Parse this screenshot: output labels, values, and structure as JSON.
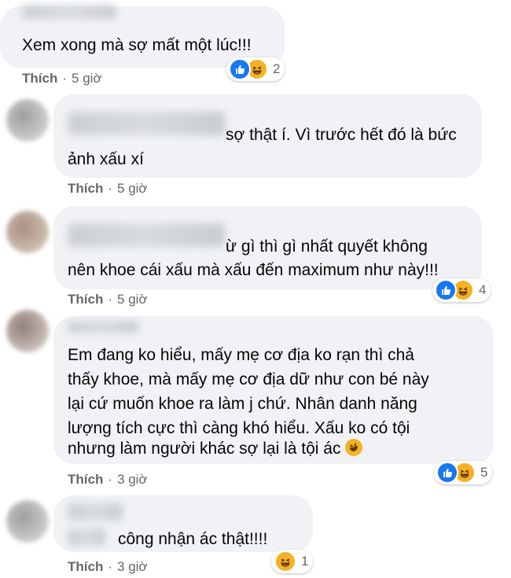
{
  "comments": [
    {
      "text_lines": [
        "Xem xong mà sợ mất một lúc!!!"
      ],
      "like_label": "Thích",
      "time": "5 giờ",
      "reactions": {
        "icons": [
          "like-icon",
          "haha-icon"
        ],
        "count": "2"
      }
    },
    {
      "text_lines": [
        "sợ thật í. Vì trước hết đó là bức",
        "ảnh xấu xí"
      ],
      "like_label": "Thích",
      "time": "5 giờ"
    },
    {
      "text_lines": [
        "ừ gì thì gì nhất quyết không",
        "nên khoe cái xấu mà xấu đến maximum như này!!!"
      ],
      "like_label": "Thích",
      "time": "5 giờ",
      "reactions": {
        "icons": [
          "like-icon",
          "haha-icon"
        ],
        "count": "4"
      }
    },
    {
      "text_lines": [
        "Em đang ko hiểu, mấy mẹ cơ địa ko rạn thì chả",
        "thấy khoe, mà mấy mẹ cơ địa dữ như con bé này",
        "lại cứ muốn khoe ra làm j chứ. Nhân danh năng",
        "lượng tích cực thì càng khó hiểu. Xấu ko có tội",
        "nhưng làm người khác sợ lại là tội ác"
      ],
      "inline_emoji": "rolling-laughing-emoji",
      "like_label": "Thích",
      "time": "3 giờ",
      "reactions": {
        "icons": [
          "like-icon",
          "haha-icon"
        ],
        "count": "5"
      }
    },
    {
      "text_lines": [
        "công nhận ác thật!!!!"
      ],
      "like_label": "Thích",
      "time": "3 giờ",
      "reactions": {
        "icons": [
          "haha-icon"
        ],
        "count": "1"
      }
    }
  ],
  "colors": {
    "bubble": "#f0f2f5",
    "meta_text": "#65676b",
    "like_blue": "#1877f2",
    "haha_yellow": "#f7b125"
  }
}
